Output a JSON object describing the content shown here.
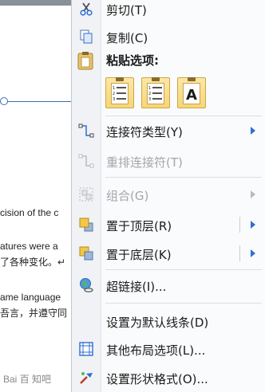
{
  "doc": {
    "text_lines": [
      "cision of the c",
      "atures were a",
      "了各种变化。↵",
      "ame  language",
      "吾言，并遵守同"
    ],
    "watermark": "Bai 百 知吧"
  },
  "menu": {
    "cut": "剪切(T)",
    "copy": "复制(C)",
    "paste_header": "粘贴选项:",
    "paste_options": [
      "keep-source-format",
      "merge-format",
      "keep-text-only"
    ],
    "connector_type": "连接符类型(Y)",
    "reroute": "重排连接符(T)",
    "group": "组合(G)",
    "bring_front": "置于顶层(R)",
    "send_back": "置于底层(K)",
    "hyperlink": "超链接(I)...",
    "set_default_line": "设置为默认线条(D)",
    "more_layout": "其他布局选项(L)...",
    "format_shape": "设置形状格式(O)..."
  },
  "colors": {
    "accent": "#2f6fd0",
    "paste_gold": "#f5d67a"
  }
}
